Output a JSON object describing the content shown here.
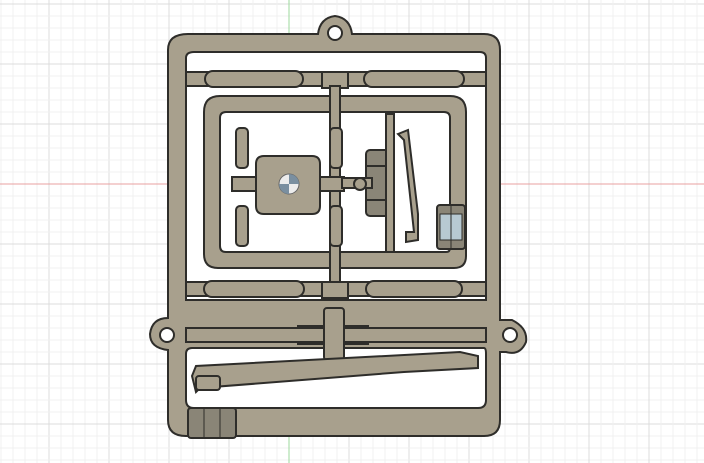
{
  "viewport": {
    "background": "#ffffff",
    "grid_major_color": "#dcdcdc",
    "grid_minor_color": "#f0f0f0",
    "x_axis_color": "#e8a0a0",
    "y_axis_color": "#9ed89e"
  },
  "model": {
    "part_fill": "#a8a08d",
    "part_stroke": "#2e2d2a",
    "cutout_fill": "#ffffff",
    "clip_fill": "#8a8577",
    "accent_fill": "#b7c9d2",
    "origin_marker": "center-origin-icon"
  }
}
